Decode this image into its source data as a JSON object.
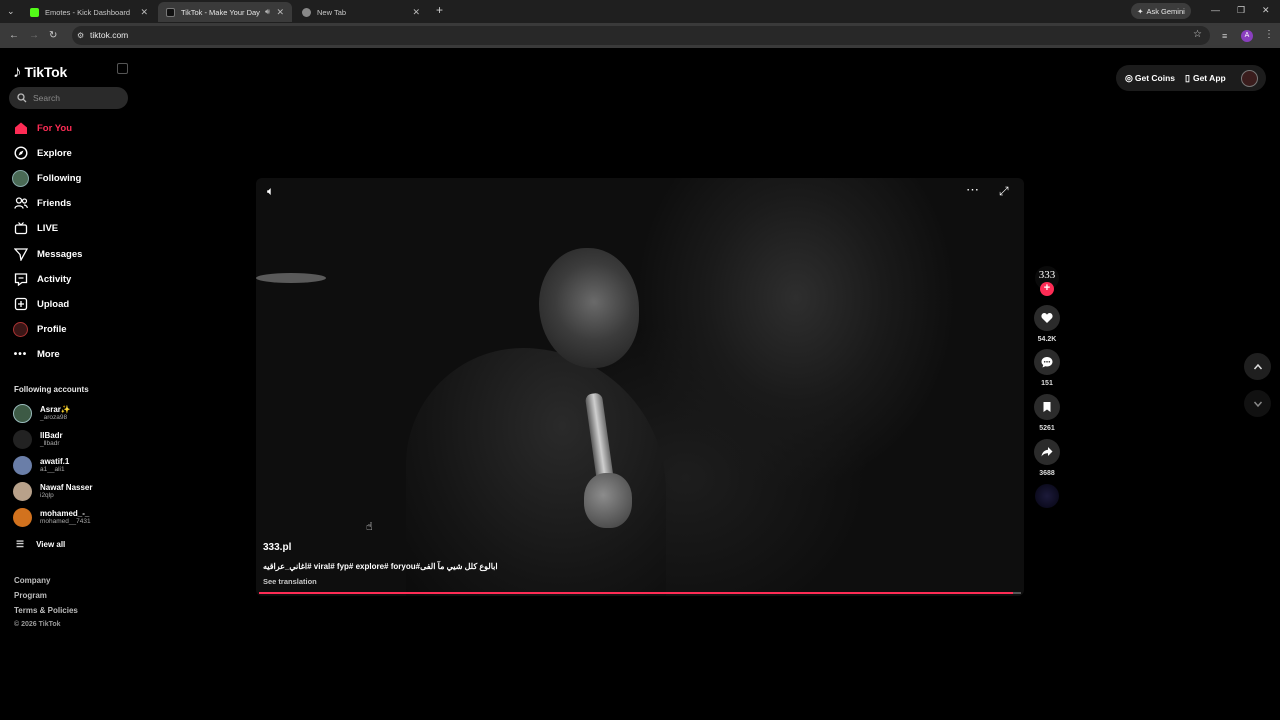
{
  "browser": {
    "tabs": [
      {
        "title": "Emotes - Kick Dashboard",
        "color": "#53fc18"
      },
      {
        "title": "TikTok - Make Your Day",
        "color": "#111111"
      },
      {
        "title": "New Tab",
        "color": "#888888"
      }
    ],
    "new_tab_symbol": "+",
    "url": "tiktok.com",
    "gemini_label": "Ask Gemini",
    "profile_initial": "A"
  },
  "sidebar": {
    "logo_text": "TikTok",
    "search_placeholder": "Search",
    "nav": [
      {
        "label": "For You",
        "icon": "home-icon"
      },
      {
        "label": "Explore",
        "icon": "compass-icon"
      },
      {
        "label": "Following",
        "icon": "following-avatar-icon"
      },
      {
        "label": "Friends",
        "icon": "friends-icon"
      },
      {
        "label": "LIVE",
        "icon": "live-tv-icon"
      },
      {
        "label": "Messages",
        "icon": "paper-plane-icon"
      },
      {
        "label": "Activity",
        "icon": "inbox-icon"
      },
      {
        "label": "Upload",
        "icon": "plus-square-icon"
      },
      {
        "label": "Profile",
        "icon": "profile-avatar-icon"
      },
      {
        "label": "More",
        "icon": "more-dots-icon"
      }
    ],
    "following_title": "Following accounts",
    "accounts": [
      {
        "name": "Asrar✨",
        "handle": "_aroza98"
      },
      {
        "name": "llBadr",
        "handle": "_llbadr"
      },
      {
        "name": "awatif.1",
        "handle": "a1__ali1"
      },
      {
        "name": "Nawaf Nasser",
        "handle": "i2qlp"
      },
      {
        "name": "mohamed_-_",
        "handle": "mohamed__7431"
      }
    ],
    "view_all": "View all",
    "footer": [
      "Company",
      "Program",
      "Terms & Policies"
    ],
    "copyright": "© 2026 TikTok"
  },
  "top_actions": {
    "coins": "Get Coins",
    "app": "Get App"
  },
  "video": {
    "author": "333.pl",
    "caption": "اغاني_عراقيه# viral# fyp# explore# foryou#ابالوع كلل شيي مآ الفى",
    "see_translation": "See translation",
    "progress": 0.99
  },
  "actions": {
    "creator_label": "333",
    "likes": "54.2K",
    "comments": "151",
    "saves": "5261",
    "shares": "3688"
  },
  "colors": {
    "accent": "#fe2c55",
    "background": "#000000"
  }
}
